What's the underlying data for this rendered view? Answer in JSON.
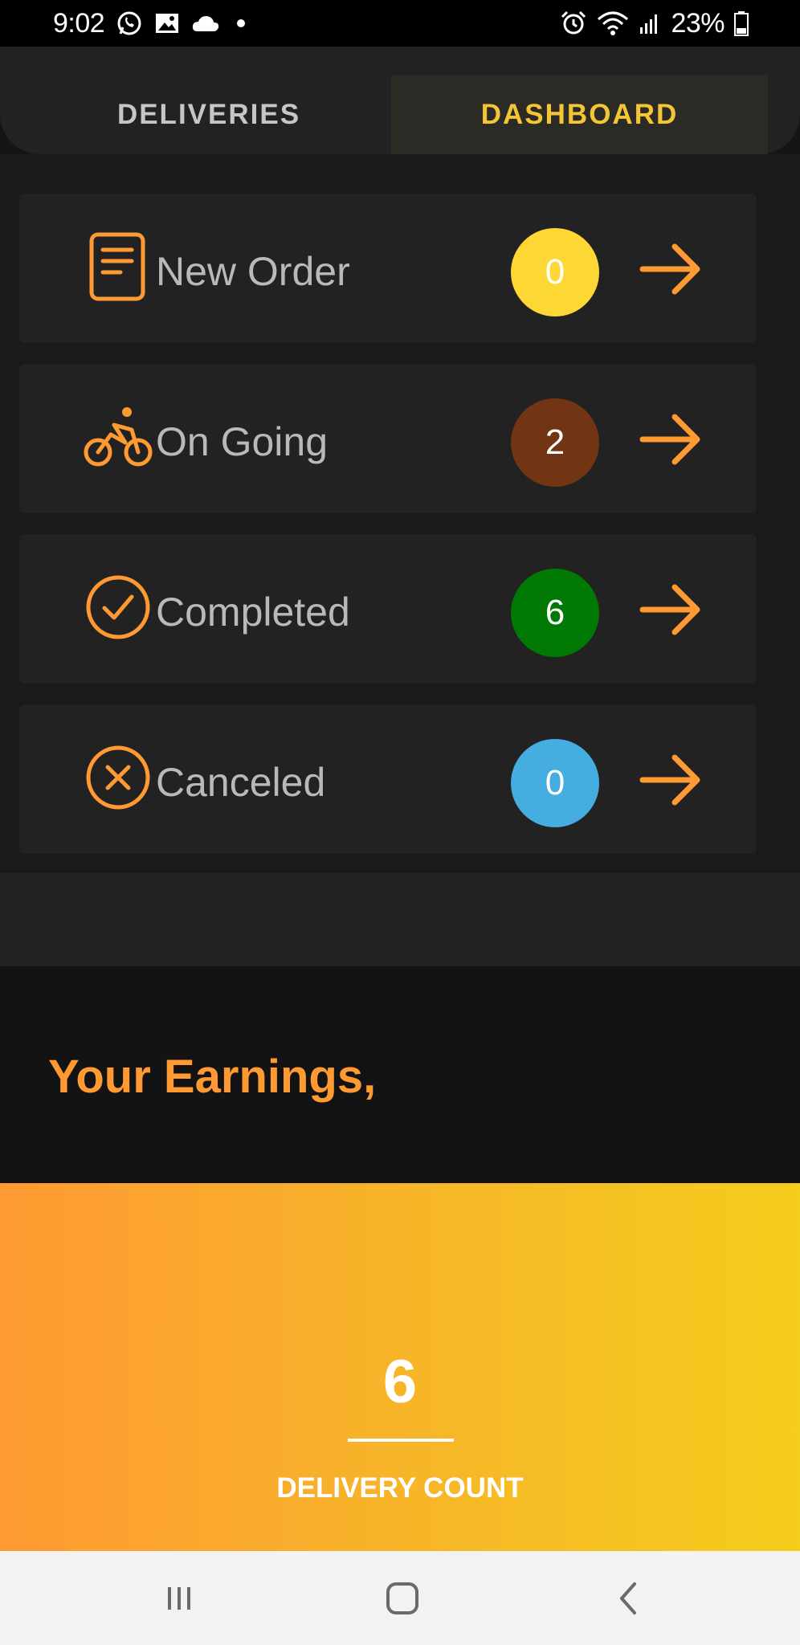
{
  "status_bar": {
    "time": "9:02",
    "battery": "23%",
    "left_icons": [
      "whatsapp-icon",
      "gallery-icon",
      "cloud-icon",
      "dot-icon"
    ],
    "right_icons": [
      "alarm-icon",
      "wifi-icon",
      "signal-icon",
      "battery-icon"
    ]
  },
  "tabs": [
    {
      "label": "DELIVERIES",
      "active": false
    },
    {
      "label": "DASHBOARD",
      "active": true
    }
  ],
  "colors": {
    "accent": "#ff9a32",
    "tab_active": "#f4c534",
    "card_bg": "#222222",
    "badge_new": "#fdd835",
    "badge_ongoing": "#723514",
    "badge_completed": "#007a05",
    "badge_canceled": "#45ade0"
  },
  "orders": [
    {
      "label": "New Order",
      "count": "0",
      "icon": "document-icon",
      "badge_color": "#fdd835"
    },
    {
      "label": "On Going",
      "count": "2",
      "icon": "bicycle-icon",
      "badge_color": "#723514"
    },
    {
      "label": "Completed",
      "count": "6",
      "icon": "check-circle-icon",
      "badge_color": "#007a05"
    },
    {
      "label": "Canceled",
      "count": "0",
      "icon": "close-circle-icon",
      "badge_color": "#45ade0"
    }
  ],
  "earnings": {
    "title": "Your Earnings,",
    "delivery_count": "6",
    "delivery_count_label": "DELIVERY COUNT"
  },
  "nav_bar": {
    "buttons": [
      "recent-apps-icon",
      "home-icon",
      "back-icon"
    ]
  }
}
